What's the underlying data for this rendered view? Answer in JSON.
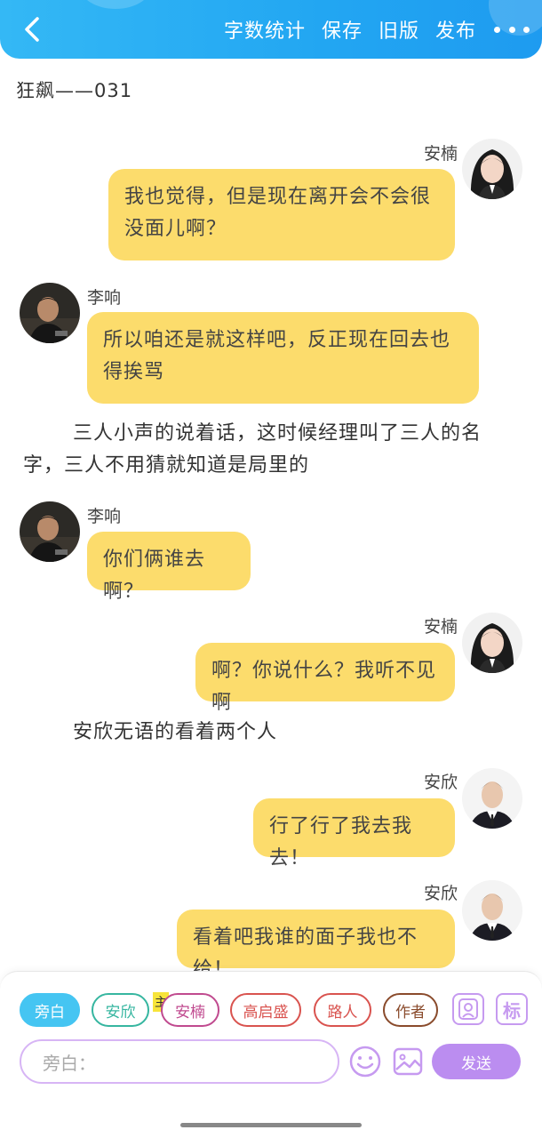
{
  "header": {
    "actions": [
      "字数统计",
      "保存",
      "旧版",
      "发布"
    ],
    "colors": {
      "from": "#34b8f5",
      "to": "#1e9bf0"
    }
  },
  "chapter_title": "狂飙——031",
  "messages": [
    {
      "type": "right",
      "name": "安楠",
      "avatar": "female-avatar",
      "text": "我也觉得，但是现在离开会不会很没面儿啊？"
    },
    {
      "type": "left",
      "name": "李响",
      "avatar": "male-avatar-dark",
      "text": "所以咱还是就这样吧，反正现在回去也得挨骂"
    },
    {
      "type": "narration",
      "text": "三人小声的说着话，这时候经理叫了三人的名字，三人不用猜就知道是局里的"
    },
    {
      "type": "left",
      "name": "李响",
      "avatar": "male-avatar-dark",
      "text": "你们俩谁去啊？"
    },
    {
      "type": "right",
      "name": "安楠",
      "avatar": "female-avatar",
      "text": "啊？你说什么？我听不见啊"
    },
    {
      "type": "narration",
      "text": "安欣无语的看着两个人"
    },
    {
      "type": "right",
      "name": "安欣",
      "avatar": "male-avatar-suit",
      "text": "行了行了我去我去！"
    },
    {
      "type": "right",
      "name": "安欣",
      "avatar": "male-avatar-suit",
      "text": "看着吧我谁的面子我也不给！"
    }
  ],
  "composer": {
    "roles": [
      {
        "label": "旁白",
        "color": "#45c5f2",
        "active": true
      },
      {
        "label": "安欣",
        "color": "#36b6a0",
        "active": false
      },
      {
        "label": "安楠",
        "color": "#c04a8f",
        "active": false
      },
      {
        "label": "高启盛",
        "color": "#d9534f",
        "active": false
      },
      {
        "label": "路人",
        "color": "#d9534f",
        "active": false
      },
      {
        "label": "作者",
        "color": "#8a4b2c",
        "active": false
      }
    ],
    "main_tag": "主",
    "mark_label": "标",
    "input_placeholder": "旁白：",
    "send_label": "发送"
  }
}
